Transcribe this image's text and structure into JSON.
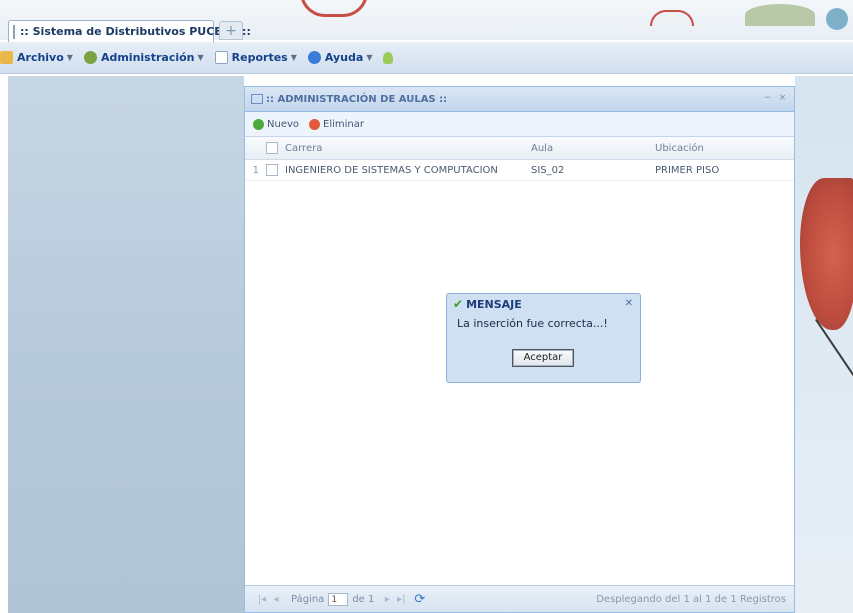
{
  "browser": {
    "tab_title": ":: Sistema de Distributivos PUCESA ::",
    "new_tab": "+"
  },
  "menubar": {
    "items": [
      {
        "label": "Archivo",
        "icon": "folder-icon"
      },
      {
        "label": "Administración",
        "icon": "settings-icon"
      },
      {
        "label": "Reportes",
        "icon": "report-icon"
      },
      {
        "label": "Ayuda",
        "icon": "help-icon"
      }
    ]
  },
  "window": {
    "title": ":: ADMINISTRACIÓN DE AULAS ::",
    "toolbar": {
      "new_label": "Nuevo",
      "delete_label": "Eliminar"
    },
    "columns": [
      "Carrera",
      "Aula",
      "Ubicación"
    ],
    "rows": [
      {
        "num": "1",
        "carrera": "INGENIERO DE SISTEMAS Y COMPUTACIÓN",
        "aula": "SIS_02",
        "ubicacion": "PRIMER PISO"
      }
    ],
    "paging": {
      "page_label": "Página",
      "page_value": "1",
      "of_label": "de 1",
      "info": "Desplegando del 1 al 1 de 1 Registros"
    }
  },
  "message": {
    "title": "MENSAJE",
    "text": "La inserción fue correcta...!",
    "button": "Aceptar"
  },
  "colors": {
    "accent": "#15428b",
    "panel_border": "#99bbe8",
    "dialog_bg": "#cfe0f3"
  }
}
